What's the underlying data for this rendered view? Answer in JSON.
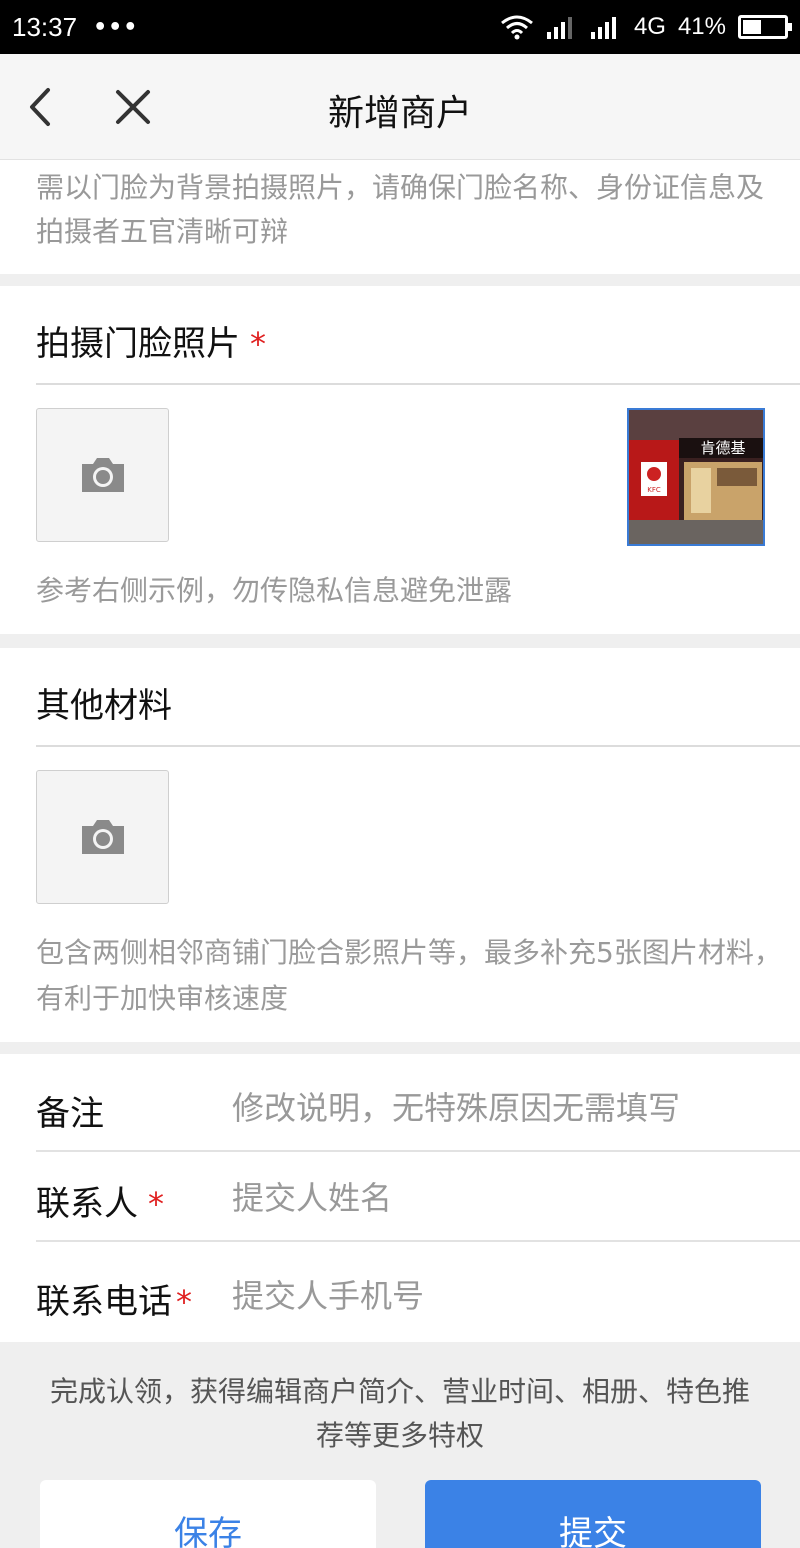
{
  "status_bar": {
    "time": "13:37",
    "dots": "•••",
    "network": "4G",
    "battery_percent": "41%",
    "battery_level": 0.41
  },
  "nav": {
    "title": "新增商户"
  },
  "notice": {
    "text": "需以门脸为背景拍摄照片，请确保门脸名称、身份证信息及拍摄者五官清晰可辩"
  },
  "storefront_section": {
    "title": "拍摄门脸照片",
    "required_mark": "*",
    "hint": "参考右侧示例，勿传隐私信息避免泄露",
    "example_sign": "肯德基",
    "example_logo": "KFC"
  },
  "other_section": {
    "title": "其他材料",
    "hint": "包含两侧相邻商铺门脸合影照片等，最多补充5张图片材料，有利于加快审核速度"
  },
  "form": {
    "remark": {
      "label": "备注",
      "placeholder": "修改说明，无特殊原因无需填写"
    },
    "contact": {
      "label": "联系人",
      "required_mark": "*",
      "placeholder": "提交人姓名"
    },
    "phone": {
      "label": "联系电话",
      "required_mark": "*",
      "placeholder": "提交人手机号"
    }
  },
  "footer": {
    "text": "完成认领，获得编辑商户简介、营业时间、相册、特色推荐等更多特权",
    "save_label": "保存",
    "submit_label": "提交"
  },
  "colors": {
    "accent": "#3b82e6",
    "required": "#e02020"
  }
}
